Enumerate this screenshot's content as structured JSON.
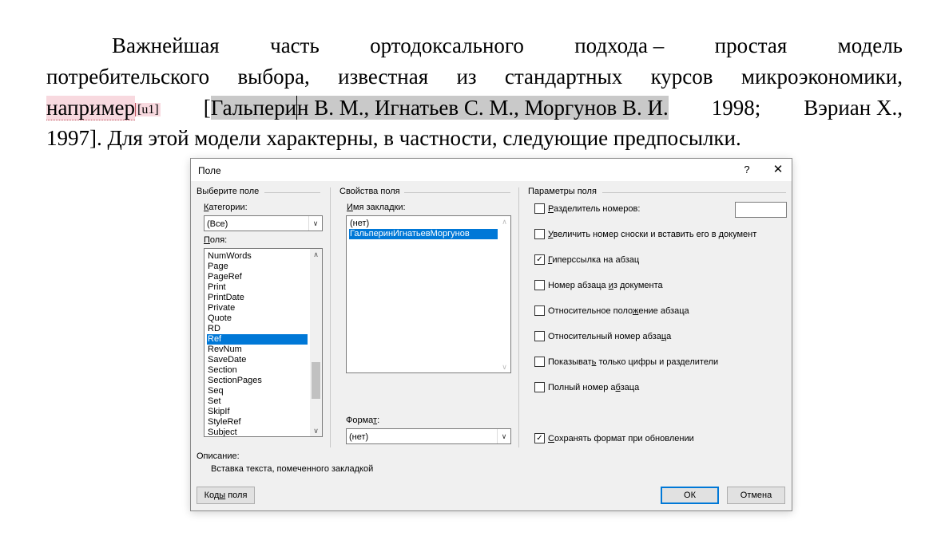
{
  "document": {
    "line1_words": [
      "Важнейшая",
      "часть",
      "ортодоксального",
      "подхода –",
      "простая",
      "модель"
    ],
    "line2_words": [
      "потребительского",
      "выбора,",
      "известная",
      "из",
      "стандартных",
      "курсов",
      "микроэкономики,"
    ],
    "line3": {
      "comment_anchor": "например",
      "comment_ref": "[u1]",
      "bracket_open": "[",
      "citation_part1": "Гальпери",
      "citation_part2": "н В. М.,  Игнатьев С. М.,  Моргунов В. И.",
      "tail_words": [
        "1998;",
        "Вэриан Х.,"
      ]
    },
    "line4": "1997]. Для этой модели характерны, в частности, следующие предпосылки."
  },
  "dialog": {
    "title": "Поле",
    "help_label": "?",
    "close_label": "✕",
    "left_section": {
      "title": "Выберите поле",
      "categories_label_pre": "",
      "categories_label_u": "К",
      "categories_label_post": "атегории:",
      "categories_value": "(Все)",
      "fields_label_pre": "",
      "fields_label_u": "П",
      "fields_label_post": "оля:",
      "fields": [
        "NumWords",
        "Page",
        "PageRef",
        "Print",
        "PrintDate",
        "Private",
        "Quote",
        "RD",
        "Ref",
        "RevNum",
        "SaveDate",
        "Section",
        "SectionPages",
        "Seq",
        "Set",
        "SkipIf",
        "StyleRef",
        "Subject"
      ],
      "selected_field": "Ref"
    },
    "middle_section": {
      "title": "Свойства поля",
      "bookmark_label_pre": "",
      "bookmark_label_u": "И",
      "bookmark_label_post": "мя закладки:",
      "bookmarks": [
        "(нет)",
        "ГальперинИгнатьевМоргунов"
      ],
      "selected_bookmark": "ГальперинИгнатьевМоргунов",
      "format_label_pre": "Форма",
      "format_label_u": "т",
      "format_label_post": ":",
      "format_value": "(нет)"
    },
    "right_section": {
      "title": "Параметры поля",
      "options": [
        {
          "pre": "",
          "u": "Р",
          "post": "азделитель номеров:",
          "checked": false
        },
        {
          "pre": "",
          "u": "У",
          "post": "величить номер сноски и вставить его в документ",
          "checked": false
        },
        {
          "pre": "",
          "u": "Г",
          "post": "иперссылка на абзац",
          "checked": true
        },
        {
          "pre": "Номер абзаца ",
          "u": "и",
          "post": "з документа",
          "checked": false
        },
        {
          "pre": "Относительное поло",
          "u": "ж",
          "post": "ение абзаца",
          "checked": false
        },
        {
          "pre": "Относительный номер абза",
          "u": "ц",
          "post": "а",
          "checked": false
        },
        {
          "pre": "Показыват",
          "u": "ь",
          "post": " только цифры и разделители",
          "checked": false
        },
        {
          "pre": "Полный номер а",
          "u": "б",
          "post": "заца",
          "checked": false
        },
        {
          "pre": "",
          "u": "С",
          "post": "охранять формат при обновлении",
          "checked": true
        }
      ]
    },
    "description": {
      "label": "Описание:",
      "text": "Вставка текста, помеченного закладкой"
    },
    "buttons": {
      "field_codes_pre": "Код",
      "field_codes_u": "ы",
      "field_codes_post": " поля",
      "ok": "ОК",
      "cancel": "Отмена"
    }
  }
}
